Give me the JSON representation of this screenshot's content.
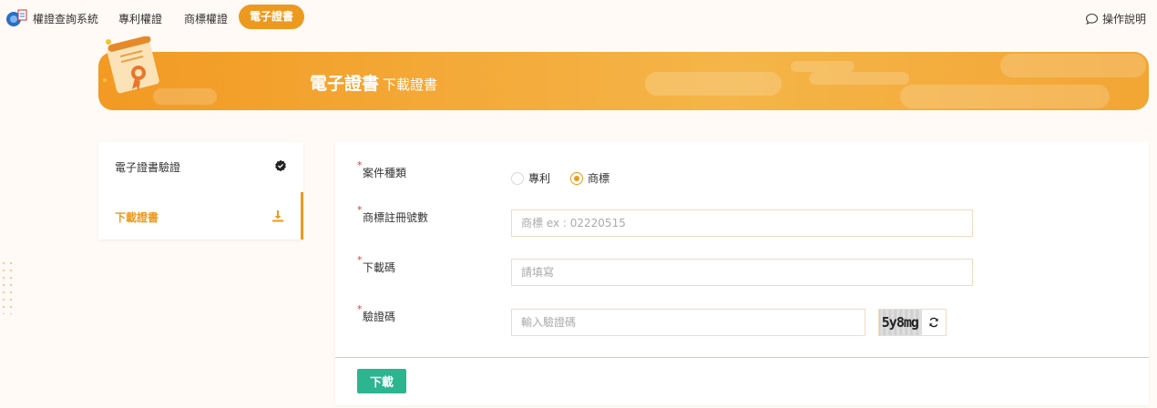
{
  "nav": {
    "brand": "權證查詢系統",
    "items": [
      "專利權證",
      "商標權證"
    ],
    "active": "電子證書",
    "help": "操作說明"
  },
  "banner": {
    "title": "電子證書",
    "subtitle": "下載證書"
  },
  "side": {
    "items": [
      {
        "label": "電子證書驗證",
        "icon": "verified-badge-icon"
      },
      {
        "label": "下載證書",
        "icon": "download-icon"
      }
    ]
  },
  "form": {
    "case_type_label": "案件種類",
    "options": [
      "專利",
      "商標"
    ],
    "selected": "商標",
    "reg_no_label": "商標註冊號數",
    "reg_no_placeholder": "商標 ex : 02220515",
    "code_label": "下載碼",
    "code_placeholder": "請填寫",
    "captcha_label": "驗證碼",
    "captcha_placeholder": "輸入驗證碼",
    "captcha_text": "5y8mg",
    "submit": "下載"
  },
  "colors": {
    "accent": "#ec9a1f",
    "submit": "#2cb58f",
    "required": "#e23b3b"
  }
}
